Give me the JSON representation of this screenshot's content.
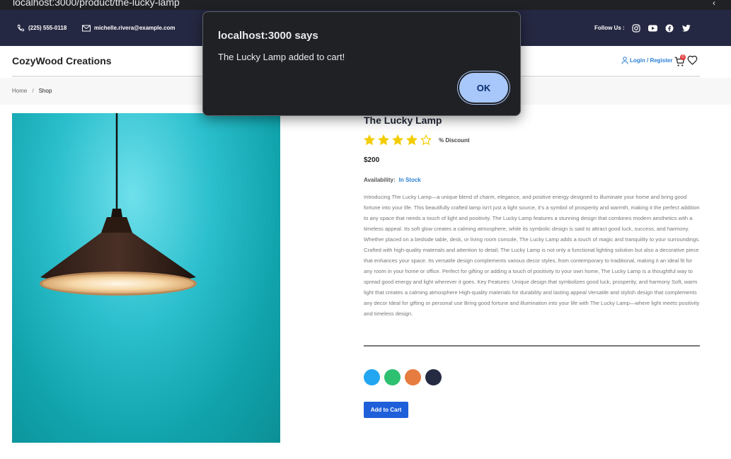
{
  "browser": {
    "url": "localhost:3000/product/the-lucky-lamp"
  },
  "topbar": {
    "phone": "(225) 555-0118",
    "email": "michelle.rivera@example.com",
    "follow_label": "Follow Us :",
    "social_icons": [
      "instagram-icon",
      "youtube-icon",
      "facebook-icon",
      "twitter-icon"
    ]
  },
  "header": {
    "brand": "CozyWood Creations",
    "login_label": "Login / Register",
    "cart_count": "0"
  },
  "breadcrumb": {
    "home": "Home",
    "current": "Shop"
  },
  "product": {
    "title": "The Lucky Lamp",
    "rating": 4,
    "rating_max": 5,
    "discount": "% Discount",
    "price": "$200",
    "availability_label": "Availability:",
    "availability_value": "In Stock",
    "description": "Introducing The Lucky Lamp—a unique blend of charm, elegance, and positive energy designed to illuminate your home and bring good fortune into your life. This beautifully crafted lamp isn't just a light source, it's a symbol of prosperity and warmth, making it the perfect addition to any space that needs a touch of light and positivity. The Lucky Lamp features a stunning design that combines modern aesthetics with a timeless appeal. Its soft glow creates a calming atmosphere, while its symbolic design is said to attract good luck, success, and harmony. Whether placed on a bedside table, desk, or living room console, The Lucky Lamp adds a touch of magic and tranquility to your surroundings. Crafted with high-quality materials and attention to detail, The Lucky Lamp is not only a functional lighting solution but also a decorative piece that enhances your space. Its versatile design complements various decor styles, from contemporary to traditional, making it an ideal fit for any room in your home or office. Perfect for gifting or adding a touch of positivity to your own home, The Lucky Lamp is a thoughtful way to spread good energy and light wherever it goes. Key Features: Unique design that symbolizes good luck, prosperity, and harmony Soft, warm light that creates a calming atmosphere High-quality materials for durability and lasting appeal Versatile and stylish design that complements any decor Ideal for gifting or personal use Bring good fortune and illumination into your life with The Lucky Lamp—where light meets positivity and timeless design.",
    "colors": [
      "#23a6f0",
      "#2dc071",
      "#e77c40",
      "#252b42"
    ],
    "add_to_cart_label": "Add to Cart"
  },
  "dialog": {
    "title": "localhost:3000 says",
    "message": "The Lucky Lamp added to cart!",
    "ok_label": "OK"
  },
  "colors": {
    "topbar_bg": "#252842",
    "accent_blue": "#2a7fd4",
    "button_blue": "#1f5fd9",
    "star_yellow": "#f3cd03"
  }
}
